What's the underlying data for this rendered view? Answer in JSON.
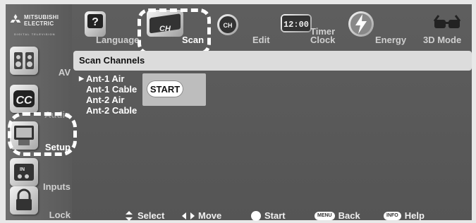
{
  "brand": {
    "line1": "MITSUBISHI",
    "line2": "ELECTRIC",
    "line3": "DIGITAL TELEVISION"
  },
  "sidebar": {
    "items": [
      {
        "label": "AV",
        "icon": "speakers-icon"
      },
      {
        "label": "Audio",
        "icon": "cc-icon"
      },
      {
        "label": "Setup",
        "icon": "tv-setup-icon"
      },
      {
        "label": "Inputs",
        "icon": "inputs-icon"
      },
      {
        "label": "Lock",
        "icon": "lock-icon"
      }
    ],
    "active": "Setup"
  },
  "topbar": {
    "items": [
      {
        "label": "Language",
        "icon": "language-icon"
      },
      {
        "label": "Scan",
        "icon": "channel-scan-icon"
      },
      {
        "label": "",
        "icon": "ch-icon"
      },
      {
        "label": "Edit",
        "icon": "edit-icon"
      },
      {
        "label": "Timer",
        "label2": "Clock",
        "icon": "clock-icon"
      },
      {
        "label": "Energy",
        "icon": "energy-icon"
      },
      {
        "label": "3D Mode",
        "icon": "3d-glasses-icon"
      }
    ],
    "active": "Scan",
    "scan_icon_text": "CH"
  },
  "clock_display": "12:00",
  "panel": {
    "title": "Scan Channels",
    "channels": [
      "Ant-1 Air",
      "Ant-1 Cable",
      "Ant-2 Air",
      "Ant-2 Cable"
    ],
    "selected_index": 0,
    "start_button": "START"
  },
  "footer": {
    "select": "Select",
    "move": "Move",
    "start": "Start",
    "back_badge": "MENU",
    "back": "Back",
    "help_badge": "INFO",
    "help": "Help"
  },
  "colors": {
    "background": "#5e5e5e",
    "titlebar": "#dcdcdc",
    "highlight": "#ffffff"
  }
}
